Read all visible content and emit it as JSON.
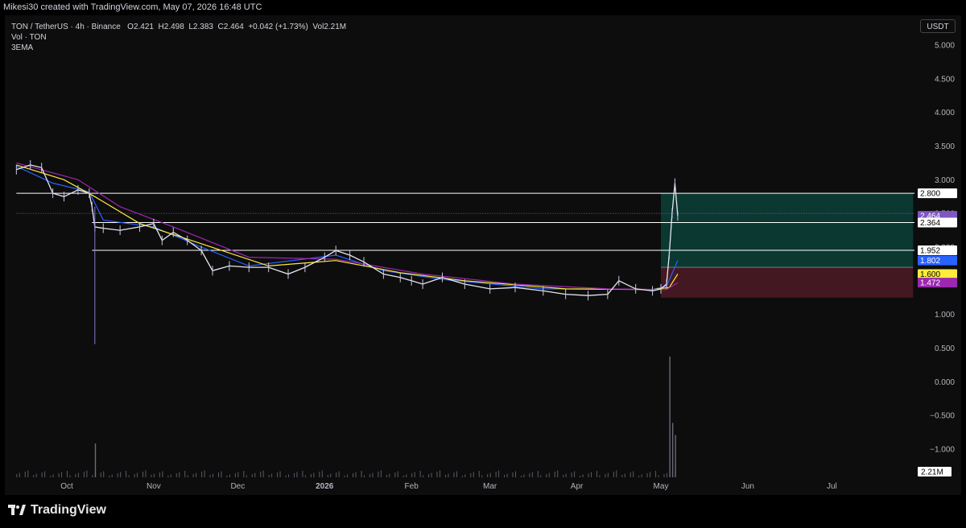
{
  "top_caption": "Mikesi30 created with TradingView.com, May 07, 2026 16:48 UTC",
  "header": {
    "symbol": "TON / TetherUS · 4h · Binance",
    "open_label": "O",
    "open": "2.421",
    "high_label": "H",
    "high": "2.498",
    "low_label": "L",
    "low": "2.383",
    "close_label": "C",
    "close": "2.464",
    "change": "+0.042 (+1.73%)",
    "vol_label": "Vol",
    "vol": "2.21M",
    "indicator1": "Vol · TON",
    "indicator2": "3EMA"
  },
  "currency": "USDT",
  "logo_text": "TradingView",
  "chart_data": {
    "type": "candlestick",
    "y_axis": {
      "ticks": [
        "5.000",
        "4.500",
        "4.000",
        "3.500",
        "3.000",
        "2.500",
        "2.000",
        "1.500",
        "1.000",
        "0.500",
        "0.000",
        "−0.500",
        "−1.000"
      ],
      "tick_values": [
        5.0,
        4.5,
        4.0,
        3.5,
        3.0,
        2.5,
        2.0,
        1.5,
        1.0,
        0.5,
        0.0,
        -0.5,
        -1.0
      ]
    },
    "x_axis": {
      "ticks": [
        "Oct",
        "Nov",
        "Dec",
        "2026",
        "Feb",
        "Mar",
        "Apr",
        "May",
        "Jun",
        "Jul"
      ],
      "bold": [
        "2026"
      ]
    },
    "price_series": [
      [
        "2025-09-13",
        3.15
      ],
      [
        "2025-09-18",
        3.22
      ],
      [
        "2025-09-22",
        3.18
      ],
      [
        "2025-09-26",
        2.8
      ],
      [
        "2025-09-30",
        2.75
      ],
      [
        "2025-10-05",
        2.85
      ],
      [
        "2025-10-09",
        2.8
      ],
      [
        "2025-10-10",
        2.6
      ],
      [
        "2025-10-11",
        2.3
      ],
      [
        "2025-10-14",
        2.28
      ],
      [
        "2025-10-20",
        2.25
      ],
      [
        "2025-10-27",
        2.3
      ],
      [
        "2025-11-01",
        2.35
      ],
      [
        "2025-11-04",
        2.1
      ],
      [
        "2025-11-08",
        2.22
      ],
      [
        "2025-11-13",
        2.1
      ],
      [
        "2025-11-18",
        1.95
      ],
      [
        "2025-11-22",
        1.65
      ],
      [
        "2025-11-28",
        1.72
      ],
      [
        "2025-12-05",
        1.7
      ],
      [
        "2025-12-12",
        1.7
      ],
      [
        "2025-12-19",
        1.6
      ],
      [
        "2025-12-25",
        1.7
      ],
      [
        "2026-01-01",
        1.85
      ],
      [
        "2026-01-05",
        1.95
      ],
      [
        "2026-01-10",
        1.88
      ],
      [
        "2026-01-15",
        1.78
      ],
      [
        "2026-01-22",
        1.6
      ],
      [
        "2026-01-28",
        1.55
      ],
      [
        "2026-02-01",
        1.5
      ],
      [
        "2026-02-05",
        1.45
      ],
      [
        "2026-02-12",
        1.55
      ],
      [
        "2026-02-20",
        1.45
      ],
      [
        "2026-03-01",
        1.38
      ],
      [
        "2026-03-10",
        1.4
      ],
      [
        "2026-03-20",
        1.35
      ],
      [
        "2026-03-28",
        1.3
      ],
      [
        "2026-04-05",
        1.28
      ],
      [
        "2026-04-12",
        1.3
      ],
      [
        "2026-04-16",
        1.5
      ],
      [
        "2026-04-22",
        1.38
      ],
      [
        "2026-04-28",
        1.35
      ],
      [
        "2026-05-01",
        1.38
      ],
      [
        "2026-05-03",
        1.45
      ],
      [
        "2026-05-04",
        1.9
      ],
      [
        "2026-05-05",
        2.5
      ],
      [
        "2026-05-06",
        2.95
      ],
      [
        "2026-05-07",
        2.464
      ]
    ],
    "wicks": [
      {
        "date": "2025-10-11",
        "low": 0.56,
        "high": 2.6
      }
    ],
    "ema_series": [
      {
        "color": "#2962ff",
        "values": [
          [
            "2025-09-13",
            3.2
          ],
          [
            "2025-09-26",
            2.95
          ],
          [
            "2025-10-09",
            2.82
          ],
          [
            "2025-10-14",
            2.4
          ],
          [
            "2025-11-01",
            2.3
          ],
          [
            "2025-11-18",
            2.0
          ],
          [
            "2025-12-05",
            1.72
          ],
          [
            "2026-01-05",
            1.88
          ],
          [
            "2026-01-22",
            1.65
          ],
          [
            "2026-02-12",
            1.52
          ],
          [
            "2026-03-20",
            1.38
          ],
          [
            "2026-04-28",
            1.37
          ],
          [
            "2026-05-03",
            1.42
          ],
          [
            "2026-05-07",
            1.802
          ]
        ]
      },
      {
        "color": "#ffeb3b",
        "values": [
          [
            "2025-09-13",
            3.22
          ],
          [
            "2025-09-30",
            3.0
          ],
          [
            "2025-10-11",
            2.75
          ],
          [
            "2025-10-27",
            2.35
          ],
          [
            "2025-11-18",
            2.05
          ],
          [
            "2025-12-12",
            1.72
          ],
          [
            "2026-01-05",
            1.8
          ],
          [
            "2026-01-28",
            1.62
          ],
          [
            "2026-02-20",
            1.5
          ],
          [
            "2026-03-28",
            1.38
          ],
          [
            "2026-04-28",
            1.37
          ],
          [
            "2026-05-04",
            1.4
          ],
          [
            "2026-05-07",
            1.6
          ]
        ]
      },
      {
        "color": "#9c27b0",
        "values": [
          [
            "2025-09-13",
            3.25
          ],
          [
            "2025-10-05",
            3.0
          ],
          [
            "2025-10-20",
            2.6
          ],
          [
            "2025-11-08",
            2.3
          ],
          [
            "2025-12-05",
            1.85
          ],
          [
            "2026-01-05",
            1.82
          ],
          [
            "2026-02-05",
            1.6
          ],
          [
            "2026-03-10",
            1.45
          ],
          [
            "2026-04-12",
            1.38
          ],
          [
            "2026-05-03",
            1.37
          ],
          [
            "2026-05-07",
            1.472
          ]
        ]
      }
    ],
    "horizontal_lines": [
      {
        "value": 2.8,
        "color": "#ffffff",
        "label": "2.800",
        "start": "2025-09-13"
      },
      {
        "value": 2.364,
        "color": "#ffffff",
        "label": "2.364",
        "start": "2025-10-10"
      },
      {
        "value": 1.952,
        "color": "#ffffff",
        "label": "1.952",
        "start": "2025-10-10"
      },
      {
        "value": 2.5,
        "color": "#7a6bd1",
        "style": "dotted",
        "start": "2025-09-13"
      }
    ],
    "position": {
      "start": "2026-05-01",
      "end": "2026-07-30",
      "target": 2.8,
      "entry": 1.7,
      "stop": 1.25
    },
    "price_labels": [
      {
        "value": 2.464,
        "text": "2.464",
        "sub": "03:11:09",
        "bg": "#7e57c2",
        "fg": "#ffffff"
      },
      {
        "value": 2.364,
        "text": "2.364",
        "bg": "#ffffff",
        "fg": "#000000"
      },
      {
        "value": 1.952,
        "text": "1.952",
        "bg": "#ffffff",
        "fg": "#000000"
      },
      {
        "value": 1.802,
        "text": "1.802",
        "bg": "#2962ff",
        "fg": "#ffffff"
      },
      {
        "value": 1.6,
        "text": "1.600",
        "bg": "#ffeb3b",
        "fg": "#000000"
      },
      {
        "value": 1.472,
        "text": "1.472",
        "bg": "#9c27b0",
        "fg": "#ffffff"
      },
      {
        "value": 2.8,
        "text": "2.800",
        "bg": "#ffffff",
        "fg": "#000000"
      }
    ],
    "volume": {
      "last": "2.21M",
      "spikes": [
        [
          "2025-10-11",
          0.28
        ],
        [
          "2026-05-04",
          1.0
        ],
        [
          "2026-05-05",
          0.45
        ],
        [
          "2026-05-06",
          0.35
        ]
      ]
    }
  }
}
